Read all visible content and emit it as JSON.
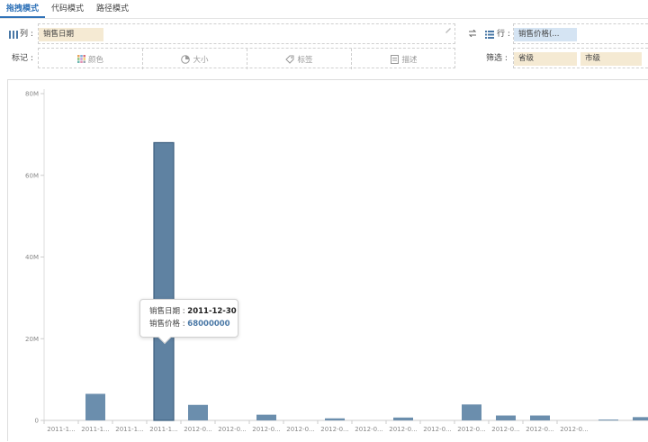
{
  "tabs": [
    {
      "label": "拖拽模式",
      "active": true
    },
    {
      "label": "代码模式",
      "active": false
    },
    {
      "label": "路径模式",
      "active": false
    }
  ],
  "columns_shelf": {
    "label": "列 :",
    "pill": "销售日期"
  },
  "rows_shelf": {
    "label": "行 :",
    "pill": "销售价格(..."
  },
  "marks_shelf": {
    "label": "标记 :",
    "buttons": [
      {
        "label": "颜色",
        "icon": "color-grid-icon"
      },
      {
        "label": "大小",
        "icon": "size-icon"
      },
      {
        "label": "标签",
        "icon": "tag-icon"
      },
      {
        "label": "描述",
        "icon": "description-icon"
      }
    ]
  },
  "filter_shelf": {
    "label": "筛选 :",
    "pills": [
      "省级",
      "市级"
    ]
  },
  "tooltip": {
    "label1": "销售日期 : ",
    "value1": "2011-12-30",
    "label2": "销售价格 : ",
    "value2": "68000000"
  },
  "colors": {
    "bar": "#6b8ead",
    "bar_highlight": "#5f82a2",
    "accent": "#2f72b8"
  },
  "chart_data": {
    "type": "bar",
    "categories": [
      "2011-1...",
      "2011-1...",
      "2011-1...",
      "2011-1...",
      "2012-0...",
      "2012-0...",
      "2012-0...",
      "2012-0...",
      "2012-0...",
      "2012-0...",
      "2012-0...",
      "2012-0...",
      "2012-0...",
      "2012-0...",
      "2012-0...",
      "2012-0..."
    ],
    "values": [
      0,
      6500000,
      0,
      68000000,
      3800000,
      0,
      1400000,
      0,
      500000,
      0,
      700000,
      0,
      3900000,
      1200000,
      1200000,
      0,
      200000,
      800000
    ],
    "y_ticks": [
      "0",
      "20M",
      "40M",
      "60M",
      "80M"
    ],
    "ylim": [
      0,
      80000000
    ],
    "title": "",
    "xlabel": "",
    "ylabel": ""
  }
}
